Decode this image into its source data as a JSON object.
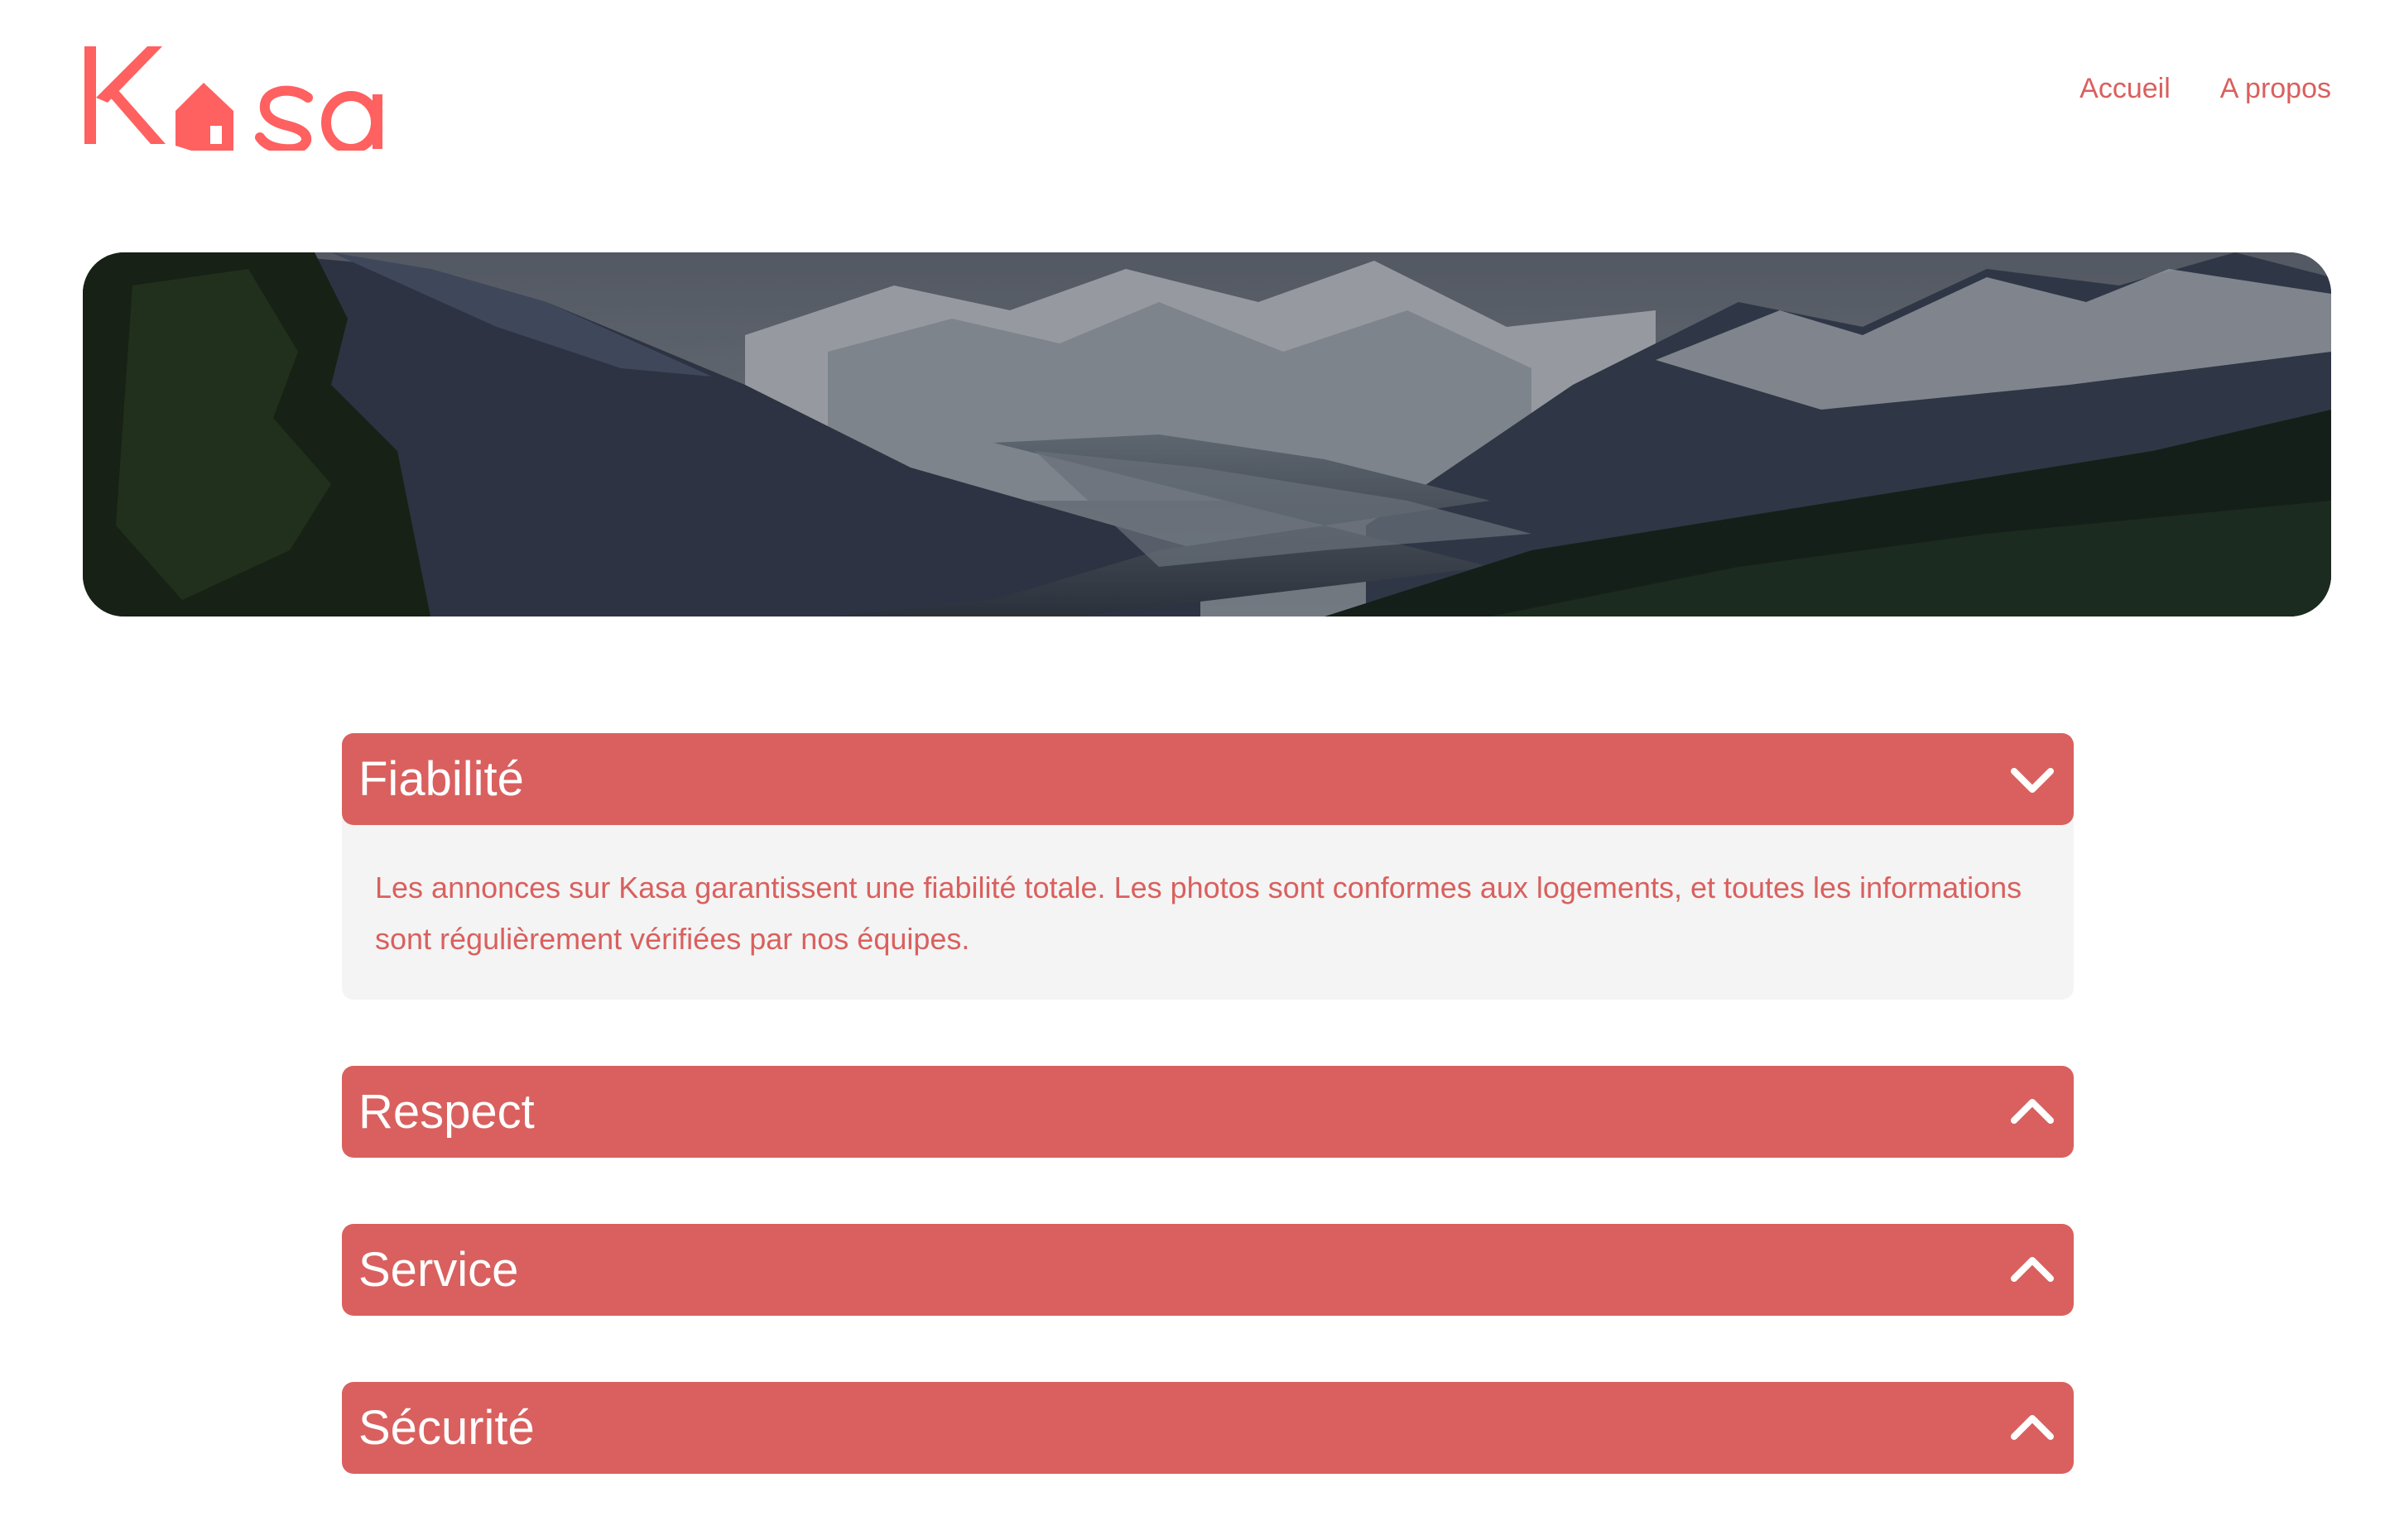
{
  "brand": {
    "name": "Kasa",
    "accent": "#D9605E",
    "logo_color": "#FF6060"
  },
  "nav": {
    "home_label": "Accueil",
    "about_label": "A propos"
  },
  "banner": {
    "image": "mountain-valley-landscape"
  },
  "collapses": [
    {
      "title": "Fiabilité",
      "open": true,
      "icon": "chevron-down-icon",
      "text": "Les annonces sur Kasa garantissent une fiabilité totale. Les photos sont conformes aux logements, et toutes les informations sont régulièrement vérifiées par nos équipes."
    },
    {
      "title": "Respect",
      "open": false,
      "icon": "chevron-up-icon"
    },
    {
      "title": "Service",
      "open": false,
      "icon": "chevron-up-icon"
    },
    {
      "title": "Sécurité",
      "open": false,
      "icon": "chevron-up-icon"
    }
  ]
}
